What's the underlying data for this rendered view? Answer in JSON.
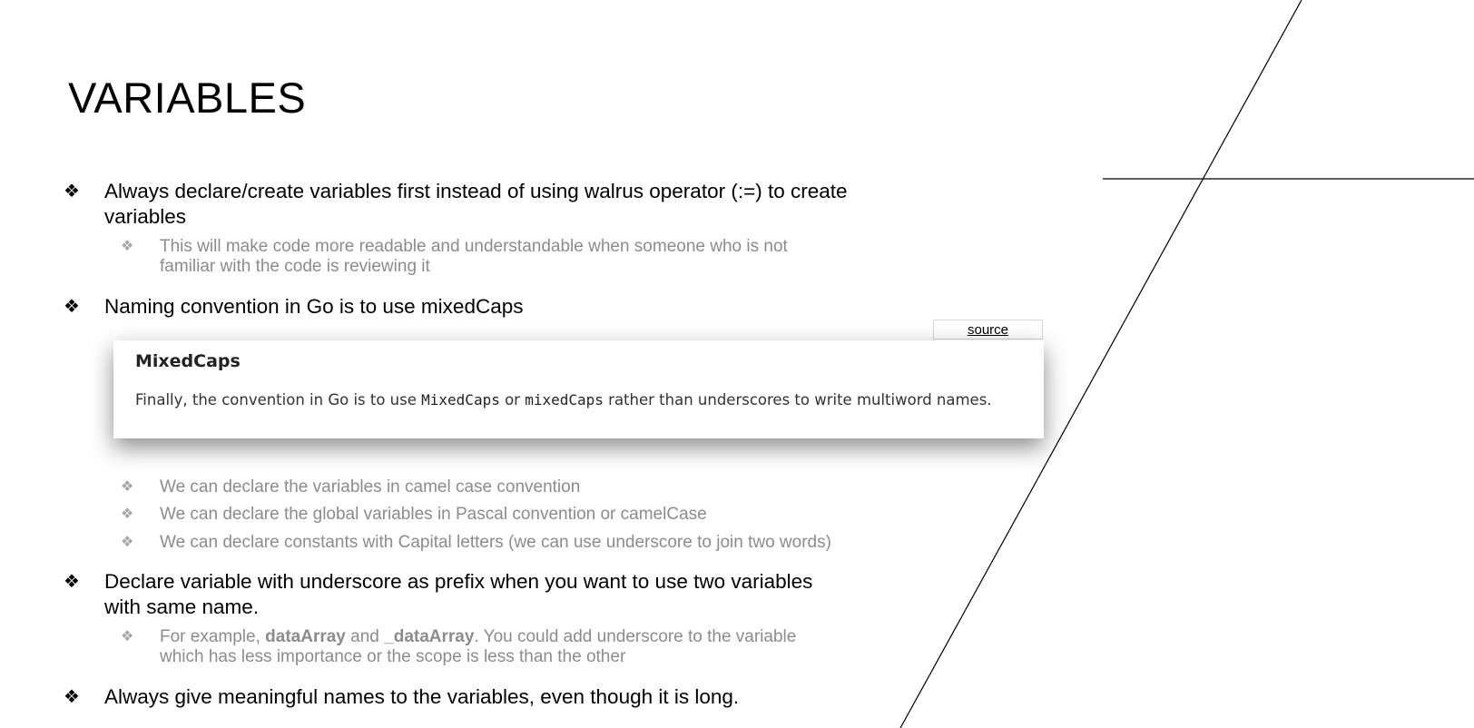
{
  "slide": {
    "title": "VARIABLES",
    "bullet_glyph": "❖",
    "bullets": [
      {
        "text_line1": "Always declare/create variables first instead of using walrus operator (:=) to create",
        "text_line2": "variables",
        "sub": {
          "line1": "This will make code more readable and understandable when someone who is not",
          "line2": "familiar with the code is reviewing it"
        }
      },
      {
        "text": "Naming convention in Go is to use mixedCaps"
      },
      {
        "text_line1": "Declare variable with underscore as prefix when you want to use two variables",
        "text_line2": "with same name.",
        "sub": {
          "prefix": "For example, ",
          "bold1": "dataArray",
          "mid": " and ",
          "bold2": "_dataArray",
          "suffix": ". You could add underscore to the variable",
          "line2": "which has less importance or the scope is less than the other"
        }
      },
      {
        "text": "Always give meaningful names to the variables, even though it is long."
      }
    ],
    "naming_subs": [
      "We can declare the variables in camel case convention",
      "We can declare the global variables in Pascal convention or camelCase",
      "We can declare constants with Capital letters (we can use underscore to join two words)"
    ],
    "source_link": "source",
    "card": {
      "title": "MixedCaps",
      "text_a": "Finally, the convention in Go is to use ",
      "code1": "MixedCaps",
      "text_b": " or ",
      "code2": "mixedCaps",
      "text_c": " rather than underscores to write multiword names."
    }
  }
}
